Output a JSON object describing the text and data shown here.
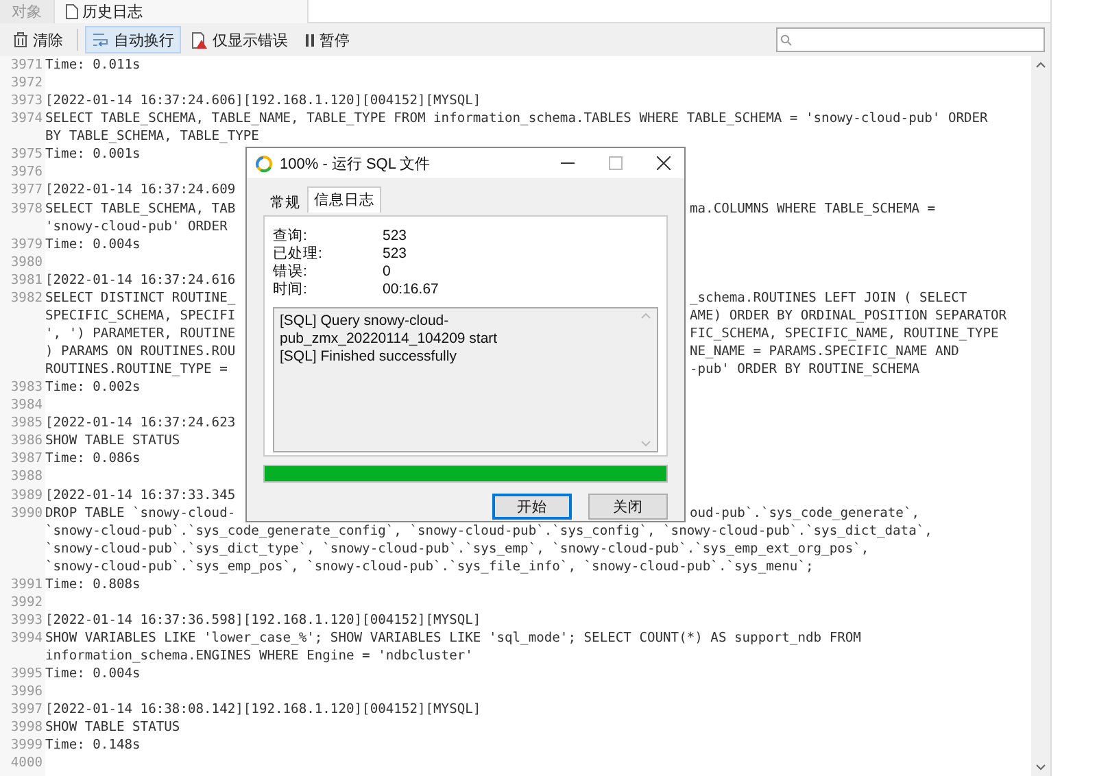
{
  "tabs": [
    {
      "label": "对象",
      "selected": false
    },
    {
      "label": "历史日志",
      "selected": true
    }
  ],
  "toolbar": [
    {
      "kind": "clear",
      "label": "清除",
      "on": false
    },
    {
      "kind": "wrap",
      "label": "自动换行",
      "on": true
    },
    {
      "kind": "errors",
      "label": "仅显示错误",
      "on": false
    },
    {
      "kind": "pause",
      "label": "暂停",
      "on": false
    }
  ],
  "log": [
    {
      "num": "3971",
      "rows": [
        [
          "Time: 0.011s"
        ]
      ]
    },
    {
      "num": "3972"
    },
    {
      "num": "3973",
      "rows": [
        [
          "[2022-01-14 16:37:24.606][192.168.1.120][004152][MYSQL]"
        ]
      ]
    },
    {
      "num": "3974",
      "rows": [
        [
          "SELECT TABLE_SCHEMA, TABLE_NAME, TABLE_TYPE FROM information_schema.TABLES WHERE TABLE_SCHEMA = 'snowy-cloud-pub' ORDER"
        ],
        [
          "BY TABLE_SCHEMA, TABLE_TYPE"
        ]
      ]
    },
    {
      "num": "3975",
      "rows": [
        [
          "Time: 0.001s"
        ]
      ]
    },
    {
      "num": "3976"
    },
    {
      "num": "3977",
      "rows": [
        [
          "[2022-01-14 16:37:24.609"
        ]
      ]
    },
    {
      "num": "3978",
      "rows": [
        [
          "SELECT TABLE_SCHEMA, TAB",
          "ma.COLUMNS WHERE TABLE_SCHEMA ="
        ],
        [
          "'snowy-cloud-pub' ORDER"
        ]
      ]
    },
    {
      "num": "3979",
      "rows": [
        [
          "Time: 0.004s"
        ]
      ]
    },
    {
      "num": "3980"
    },
    {
      "num": "3981",
      "rows": [
        [
          "[2022-01-14 16:37:24.616"
        ]
      ]
    },
    {
      "num": "3982",
      "rows": [
        [
          "SELECT DISTINCT ROUTINE_",
          "_schema.ROUTINES LEFT JOIN ( SELECT"
        ],
        [
          "SPECIFIC_SCHEMA, SPECIFI",
          "AME) ORDER BY ORDINAL_POSITION SEPARATOR"
        ],
        [
          "', ') PARAMETER, ROUTINE",
          "FIC_SCHEMA, SPECIFIC_NAME, ROUTINE_TYPE"
        ],
        [
          ") PARAMS ON ROUTINES.ROU",
          "NE_NAME = PARAMS.SPECIFIC_NAME AND"
        ],
        [
          "ROUTINES.ROUTINE_TYPE =",
          "-pub' ORDER BY ROUTINE_SCHEMA"
        ]
      ]
    },
    {
      "num": "3983",
      "rows": [
        [
          "Time: 0.002s"
        ]
      ]
    },
    {
      "num": "3984"
    },
    {
      "num": "3985",
      "rows": [
        [
          "[2022-01-14 16:37:24.623"
        ]
      ]
    },
    {
      "num": "3986",
      "rows": [
        [
          "SHOW TABLE STATUS"
        ]
      ]
    },
    {
      "num": "3987",
      "rows": [
        [
          "Time: 0.086s"
        ]
      ]
    },
    {
      "num": "3988"
    },
    {
      "num": "3989",
      "rows": [
        [
          "[2022-01-14 16:37:33.345"
        ]
      ]
    },
    {
      "num": "3990",
      "rows": [
        [
          "DROP TABLE `snowy-cloud-",
          "oud-pub`.`sys_code_generate`,"
        ],
        [
          "`snowy-cloud-pub`.`sys_code_generate_config`, `snowy-cloud-pub`.`sys_config`, `snowy-cloud-pub`.`sys_dict_data`,"
        ],
        [
          "`snowy-cloud-pub`.`sys_dict_type`, `snowy-cloud-pub`.`sys_emp`, `snowy-cloud-pub`.`sys_emp_ext_org_pos`,"
        ],
        [
          "`snowy-cloud-pub`.`sys_emp_pos`, `snowy-cloud-pub`.`sys_file_info`, `snowy-cloud-pub`.`sys_menu`;"
        ]
      ]
    },
    {
      "num": "3991",
      "rows": [
        [
          "Time: 0.808s"
        ]
      ]
    },
    {
      "num": "3992"
    },
    {
      "num": "3993",
      "rows": [
        [
          "[2022-01-14 16:37:36.598][192.168.1.120][004152][MYSQL]"
        ]
      ]
    },
    {
      "num": "3994",
      "rows": [
        [
          "SHOW VARIABLES LIKE 'lower_case_%'; SHOW VARIABLES LIKE 'sql_mode'; SELECT COUNT(*) AS support_ndb FROM"
        ],
        [
          "information_schema.ENGINES WHERE Engine = 'ndbcluster'"
        ]
      ]
    },
    {
      "num": "3995",
      "rows": [
        [
          "Time: 0.004s"
        ]
      ]
    },
    {
      "num": "3996"
    },
    {
      "num": "3997",
      "rows": [
        [
          "[2022-01-14 16:38:08.142][192.168.1.120][004152][MYSQL]"
        ]
      ]
    },
    {
      "num": "3998",
      "rows": [
        [
          "SHOW TABLE STATUS"
        ]
      ]
    },
    {
      "num": "3999",
      "rows": [
        [
          "Time: 0.148s"
        ]
      ]
    },
    {
      "num": "4000"
    }
  ],
  "dialog": {
    "title": "100% - 运行 SQL 文件",
    "tabs": [
      {
        "label": "常规",
        "selected": false
      },
      {
        "label": "信息日志",
        "selected": true
      }
    ],
    "stats": [
      {
        "label": "查询:",
        "value": "523"
      },
      {
        "label": "已处理:",
        "value": "523"
      },
      {
        "label": "错误:",
        "value": "0"
      },
      {
        "label": "时间:",
        "value": "00:16.67"
      }
    ],
    "messages": [
      "[SQL] Query snowy-cloud-pub_zmx_20220114_104209 start",
      "[SQL] Finished successfully"
    ],
    "progress": {
      "level": 1
    },
    "buttons": [
      {
        "label": "开始",
        "default": true
      },
      {
        "label": "关闭",
        "default": false
      }
    ]
  }
}
